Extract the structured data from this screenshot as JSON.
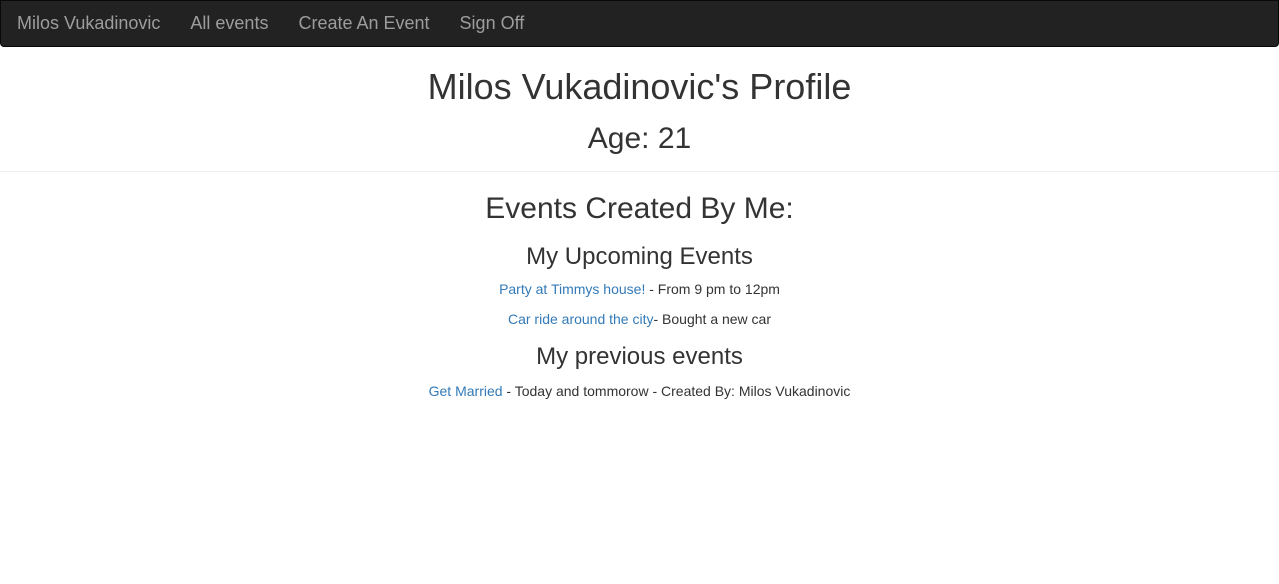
{
  "navbar": {
    "brand": "Milos Vukadinovic",
    "links": [
      "All events",
      "Create An Event",
      "Sign Off"
    ]
  },
  "profile": {
    "title": "Milos Vukadinovic's Profile",
    "age": "Age: 21"
  },
  "events": {
    "title": "Events Created By Me:",
    "upcoming": {
      "title": "My Upcoming Events",
      "items": [
        {
          "link": "Party at Timmys house!",
          "detail": " - From 9 pm to 12pm"
        },
        {
          "link": "Car ride around the city",
          "detail": "- Bought a new car"
        }
      ]
    },
    "previous": {
      "title": "My previous events",
      "items": [
        {
          "link": "Get Married",
          "detail": " - Today and tommorow - Created By: Milos Vukadinovic"
        }
      ]
    }
  },
  "colors": {
    "navbar_bg": "#222222",
    "nav_text": "#9d9d9d",
    "link": "#337ab7",
    "text": "#333333"
  }
}
